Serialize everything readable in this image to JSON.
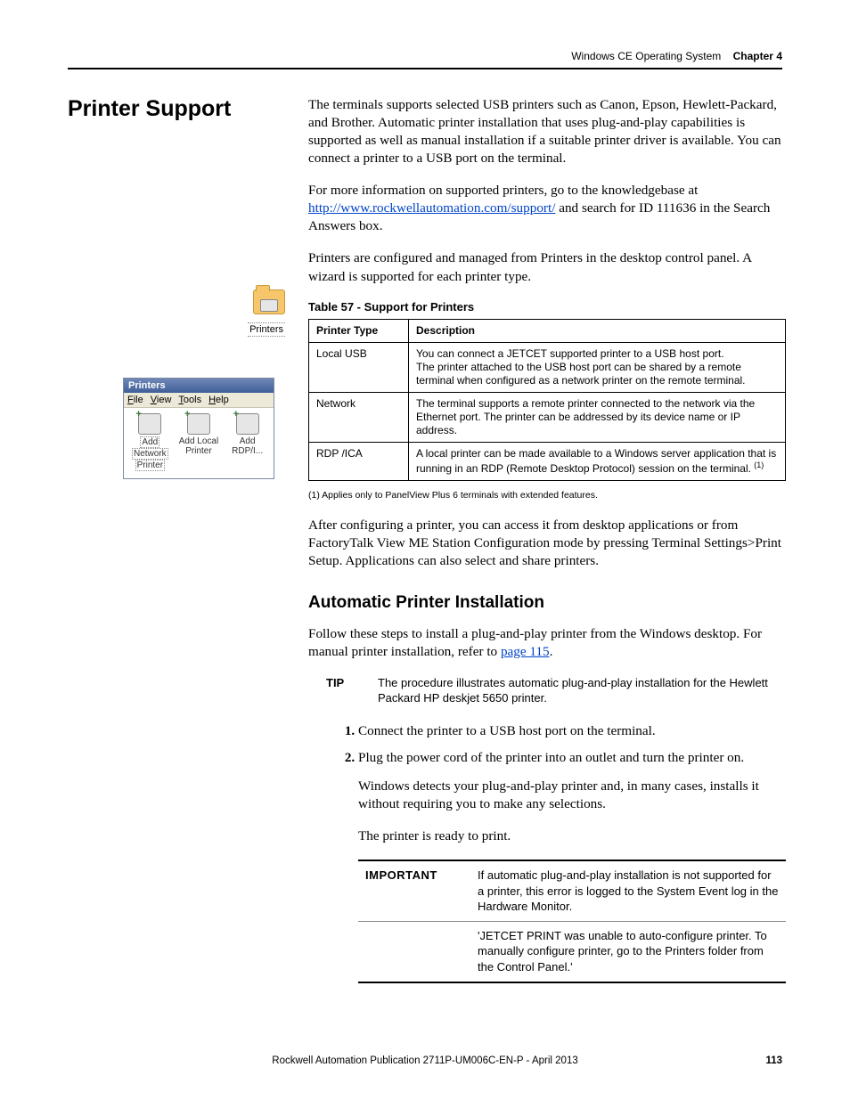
{
  "header": {
    "doc": "Windows CE Operating System",
    "chapter": "Chapter 4"
  },
  "section_title": "Printer Support",
  "intro_p1": "The terminals supports selected USB printers such as Canon, Epson, Hewlett-Packard, and Brother. Automatic printer installation that uses plug-and-play capabilities is supported as well as manual installation if a suitable printer driver is available. You can connect a printer to a USB port on the terminal.",
  "intro_p2_a": "For more information on supported printers, go to the knowledgebase at ",
  "intro_p2_link": "http://www.rockwellautomation.com/support/",
  "intro_p2_b": " and search for ID 111636 in the Search Answers box.",
  "intro_p3": "Printers are configured and managed from Printers in the desktop control panel. A wizard is supported for each printer type.",
  "table_title": "Table 57 - Support for Printers",
  "table": {
    "h1": "Printer Type",
    "h2": "Description",
    "rows": [
      {
        "t": "Local USB",
        "d1": "You can connect a JETCET supported printer to a USB host port.",
        "d2": "The printer attached to the USB host port can be shared by a remote terminal when configured as a network printer on the remote terminal."
      },
      {
        "t": "Network",
        "d1": "The terminal supports a remote printer connected to the network via the Ethernet port. The printer can be addressed by its device name or IP address."
      },
      {
        "t": "RDP /ICA",
        "d1": "A local printer can be made available to a Windows server application that is running in an RDP (Remote Desktop Protocol) session on the terminal. "
      }
    ]
  },
  "footnote_marker": "(1)",
  "footnote": "(1)   Applies only to PanelView Plus 6 terminals with extended features.",
  "after_table_p": "After configuring a printer, you can access it from desktop applications or from FactoryTalk View ME Station Configuration mode by pressing Terminal Settings>Print Setup. Applications can also select and share printers.",
  "subheading": "Automatic Printer Installation",
  "auto_p1_a": "Follow these steps to install a plug-and-play printer from the Windows desktop. For manual printer installation, refer to ",
  "auto_p1_link": "page 115",
  "auto_p1_b": ".",
  "tip_label": "TIP",
  "tip_body": "The procedure illustrates automatic plug-and-play installation for the Hewlett Packard HP deskjet 5650 printer.",
  "steps": {
    "s1": "Connect the printer to a USB host port on the terminal.",
    "s2": "Plug the power cord of the printer into an outlet and turn the printer on."
  },
  "step_after": "Windows detects your plug-and-play printer and, in many cases, installs it without requiring you to make any selections.",
  "ready_p": "The printer is ready to print.",
  "important": {
    "label": "IMPORTANT",
    "r1": "If automatic plug-and-play installation is not supported for a printer, this error is logged to the System Event log in the Hardware Monitor.",
    "r2": "'JETCET PRINT was unable to auto-configure printer. To manually configure printer, go to the Printers folder from the Control Panel.'"
  },
  "left": {
    "icon_caption": "Printers",
    "win_title": "Printers",
    "menu": {
      "m1": "File",
      "m2": "View",
      "m3": "Tools",
      "m4": "Help"
    },
    "items": {
      "i1a": "Add",
      "i1b": "Network",
      "i1c": "Printer",
      "i2a": "Add Local",
      "i2b": "Printer",
      "i3a": "Add",
      "i3b": "RDP/I..."
    }
  },
  "footer": {
    "pub": "Rockwell Automation Publication 2711P-UM006C-EN-P - April 2013",
    "page": "113"
  }
}
